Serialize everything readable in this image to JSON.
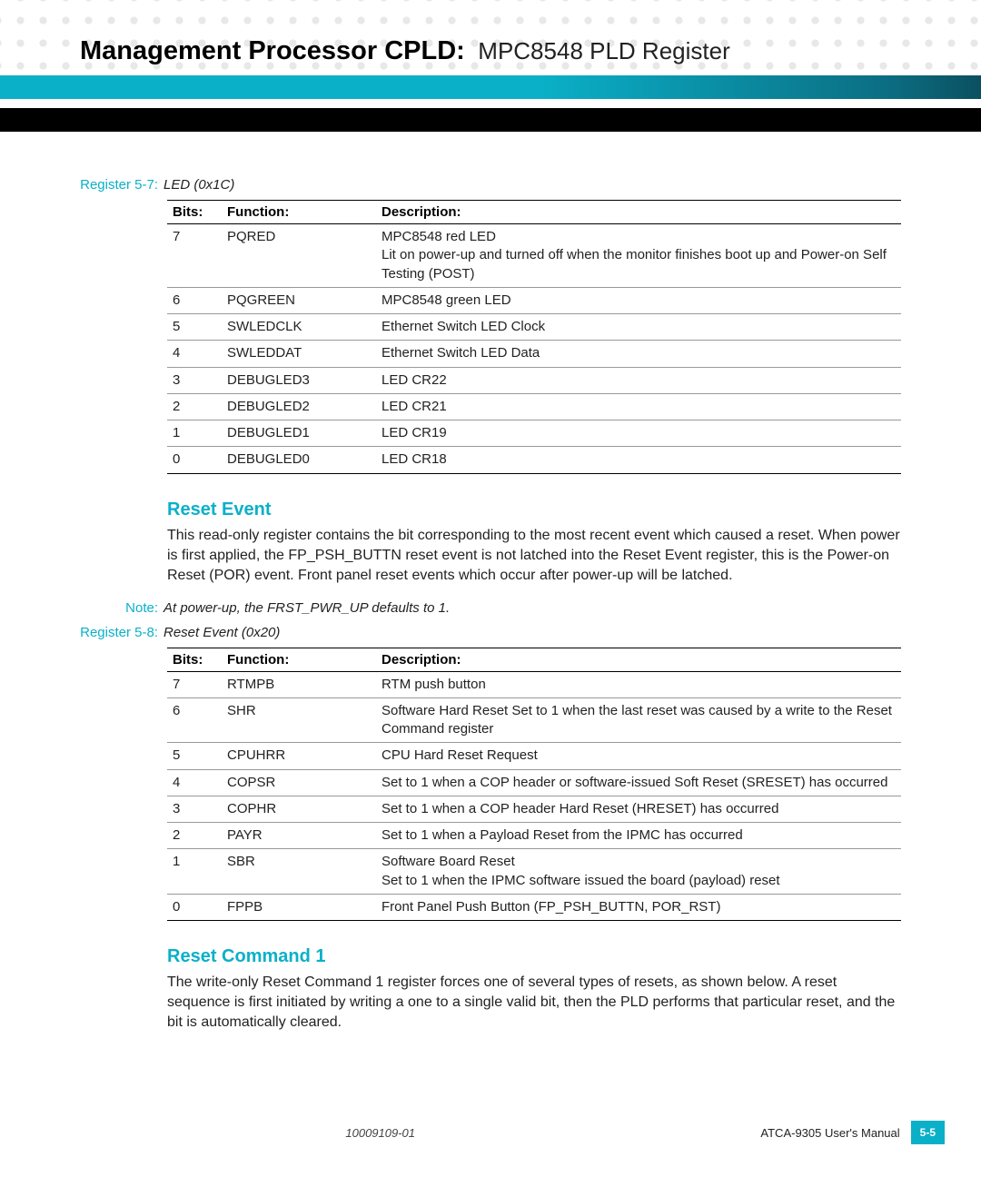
{
  "header": {
    "title_bold": "Management Processor CPLD:",
    "title_light": "MPC8548 PLD Register"
  },
  "register_57": {
    "label": "Register 5-7:",
    "title": "LED (0x1C)",
    "columns": {
      "bits": "Bits:",
      "function": "Function:",
      "description": "Description:"
    },
    "rows": [
      {
        "bits": "7",
        "function": "PQRED",
        "description": "MPC8548 red LED\nLit on power-up and turned off when the monitor finishes boot up and Power-on Self Testing (POST)"
      },
      {
        "bits": "6",
        "function": "PQGREEN",
        "description": "MPC8548 green LED"
      },
      {
        "bits": "5",
        "function": "SWLEDCLK",
        "description": "Ethernet Switch LED Clock"
      },
      {
        "bits": "4",
        "function": "SWLEDDAT",
        "description": "Ethernet Switch LED Data"
      },
      {
        "bits": "3",
        "function": "DEBUGLED3",
        "description": "LED CR22"
      },
      {
        "bits": "2",
        "function": "DEBUGLED2",
        "description": "LED CR21"
      },
      {
        "bits": "1",
        "function": "DEBUGLED1",
        "description": "LED CR19"
      },
      {
        "bits": "0",
        "function": "DEBUGLED0",
        "description": "LED CR18"
      }
    ]
  },
  "reset_event": {
    "heading": "Reset Event",
    "body": "This read-only register contains the bit corresponding to the most recent event which caused a reset. When power is first applied, the FP_PSH_BUTTN reset event is not latched into the Reset Event register, this is the Power-on Reset (POR) event. Front panel reset events which occur after power-up will be latched."
  },
  "note": {
    "label": "Note:",
    "text": "At power-up, the FRST_PWR_UP defaults to 1."
  },
  "register_58": {
    "label": "Register 5-8:",
    "title": "Reset Event (0x20)",
    "columns": {
      "bits": "Bits:",
      "function": "Function:",
      "description": "Description:"
    },
    "rows": [
      {
        "bits": "7",
        "function": "RTMPB",
        "description": "RTM push button"
      },
      {
        "bits": "6",
        "function": "SHR",
        "description": "Software Hard Reset    Set to 1 when the last reset was caused by a write to the Reset Command register"
      },
      {
        "bits": "5",
        "function": "CPUHRR",
        "description": "CPU Hard Reset Request"
      },
      {
        "bits": "4",
        "function": "COPSR",
        "description": "Set to 1 when a COP header or software-issued Soft Reset (SRESET) has occurred"
      },
      {
        "bits": "3",
        "function": "COPHR",
        "description": "Set to 1 when a COP header Hard Reset (HRESET) has occurred"
      },
      {
        "bits": "2",
        "function": "PAYR",
        "description": "Set to 1 when a Payload Reset from the IPMC has occurred"
      },
      {
        "bits": "1",
        "function": "SBR",
        "description": "Software Board Reset\nSet to 1 when the IPMC software issued the board (payload) reset"
      },
      {
        "bits": "0",
        "function": "FPPB",
        "description": "Front Panel Push Button (FP_PSH_BUTTN, POR_RST)"
      }
    ]
  },
  "reset_command": {
    "heading": "Reset Command 1",
    "body": "The write-only Reset Command 1 register forces one of several types of resets, as shown below. A reset sequence is first initiated by writing a one to a single valid bit, then the PLD performs that particular reset, and the bit is automatically cleared."
  },
  "footer": {
    "doc_id": "10009109-01",
    "manual": "ATCA-9305 User's Manual",
    "page": "5-5"
  }
}
